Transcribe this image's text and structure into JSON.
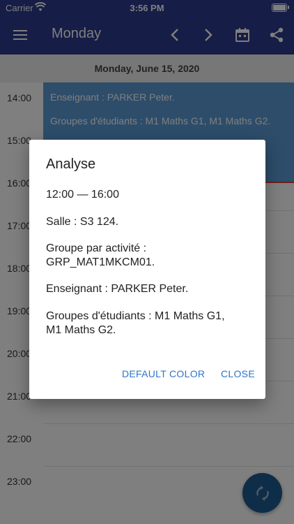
{
  "status_bar": {
    "carrier": "Carrier",
    "time": "3:56 PM"
  },
  "app_bar": {
    "title": "Monday",
    "icons": [
      "menu-icon",
      "chevron-left-icon",
      "chevron-right-icon",
      "calendar-icon",
      "share-icon"
    ]
  },
  "date_header": "Monday, June 15, 2020",
  "timeline": {
    "hours": [
      "14:00",
      "15:00",
      "16:00",
      "17:00",
      "18:00",
      "19:00",
      "20:00",
      "21:00",
      "22:00",
      "23:00"
    ],
    "event": {
      "teacher": "Enseignant : PARKER Peter.",
      "groups": "Groupes d'étudiants : M1 Maths G1, M1 Maths G2."
    }
  },
  "dialog": {
    "title": "Analyse",
    "time_range": "12:00 — 16:00",
    "room": "Salle : S3 124.",
    "activity_group_label": "Groupe par activité :",
    "activity_group_value": "GRP_MAT1MKCM01.",
    "teacher": "Enseignant : PARKER Peter.",
    "student_groups_line1": "Groupes d'étudiants : M1 Maths G1,",
    "student_groups_line2": "M1 Maths G2.",
    "default_color_button": "DEFAULT COLOR",
    "close_button": "CLOSE"
  },
  "colors": {
    "primary": "#2c3a8c",
    "event": "#5b9bd5",
    "accent_text": "#2d74c9",
    "fab": "#1d5b91"
  }
}
